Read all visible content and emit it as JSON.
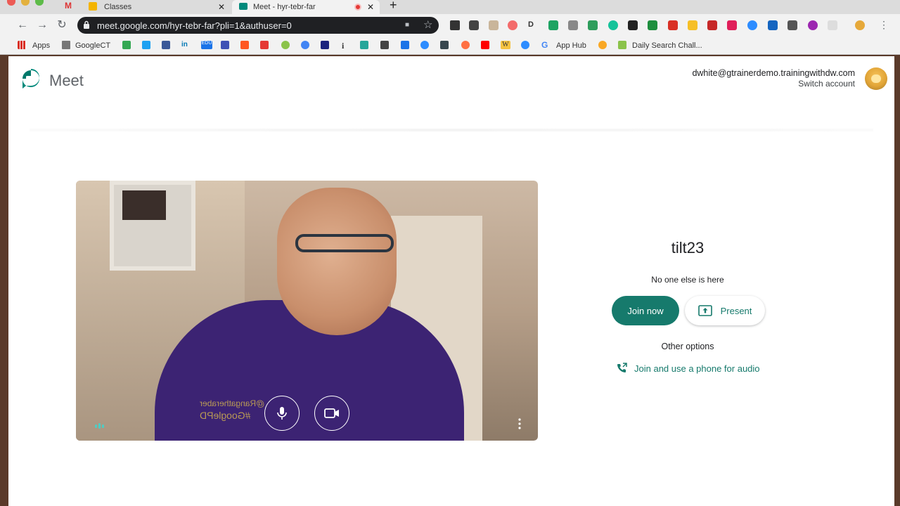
{
  "browser": {
    "tabs": [
      {
        "title": "Classes"
      },
      {
        "title": "Meet - hyr-tebr-far"
      }
    ],
    "new_tab": "+",
    "url": "meet.google.com/hyr-tebr-far?pli=1&authuser=0",
    "nav": {
      "back": "←",
      "forward": "→",
      "reload": "↻",
      "bookmark_star": "☆",
      "camera_indicator": "■"
    },
    "bookmarks": [
      {
        "label": "Apps"
      },
      {
        "label": "GoogleCT"
      },
      {
        "label": "App Hub"
      },
      {
        "label": "Daily Search Chall..."
      }
    ],
    "bookmark_icon_texts": {
      "linkedin": "in",
      "edu": "EDU",
      "info": "i",
      "wiki": "W",
      "google": "G"
    },
    "ext_letter": "D"
  },
  "meet": {
    "brand": "Meet",
    "account": {
      "email": "dwhite@gtrainerdemo.trainingwithdw.com",
      "switch": "Switch account"
    },
    "preview": {
      "mic_icon": "microphone-icon",
      "camera_icon": "video-camera-icon",
      "more_icon": "more-vert-icon",
      "shirt_text_1": "@Rangatheraber",
      "shirt_text_2": "#GooglePD"
    },
    "meeting_code": "tilt23",
    "status": "No one else is here",
    "join_label": "Join now",
    "present_label": "Present",
    "other_options": "Other options",
    "phone_audio": "Join and use a phone for audio"
  },
  "colors": {
    "accent": "#167a6c",
    "omnibox_bg": "#1f2023",
    "page_bg": "#ffffff"
  }
}
